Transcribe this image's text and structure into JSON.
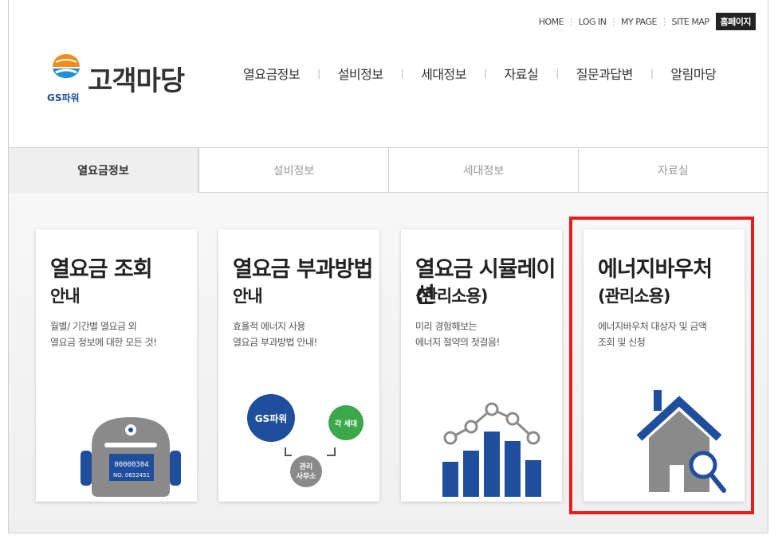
{
  "util_nav": {
    "home": "HOME",
    "login": "LOG IN",
    "mypage": "MY PAGE",
    "sitemap": "SITE MAP",
    "homepage": "홈페이지"
  },
  "logo": {
    "title": "고객마당",
    "sub": "GS파워"
  },
  "gnb": [
    "열요금정보",
    "설비정보",
    "세대정보",
    "자료실",
    "질문과답변",
    "알림마당"
  ],
  "tabs": [
    {
      "label": "열요금정보",
      "active": true
    },
    {
      "label": "설비정보",
      "active": false
    },
    {
      "label": "세대정보",
      "active": false
    },
    {
      "label": "자료실",
      "active": false
    }
  ],
  "cards": [
    {
      "title": "열요금 조회",
      "title2": "안내",
      "desc1": "월별/ 기간별 열요금 외",
      "desc2": "열요금 정보에 대한 모든 것!",
      "meter_digits": "00000304",
      "meter_no": "NO. 0652451"
    },
    {
      "title": "열요금 부과방법",
      "title2": "안내",
      "desc1": "효율적 에너지 사용",
      "desc2": "열요금 부과방법 안내!",
      "c1": "GS파워",
      "c2": "각 세대",
      "c3a": "관리",
      "c3b": "사무소"
    },
    {
      "title": "열요금 시뮬레이션",
      "title2": "(관리소용)",
      "desc1": "미리 경험해보는",
      "desc2": "에너지 절약의 첫걸음!"
    },
    {
      "title": "에너지바우처",
      "title2": "(관리소용)",
      "desc1": "에너지바우처 대상자 및 금액",
      "desc2": "조회 및 신청"
    }
  ],
  "colors": {
    "accent_blue": "#1f4e9c",
    "highlight_red": "#e81c1c",
    "green": "#3aa84b",
    "gray": "#8a8a8a"
  }
}
